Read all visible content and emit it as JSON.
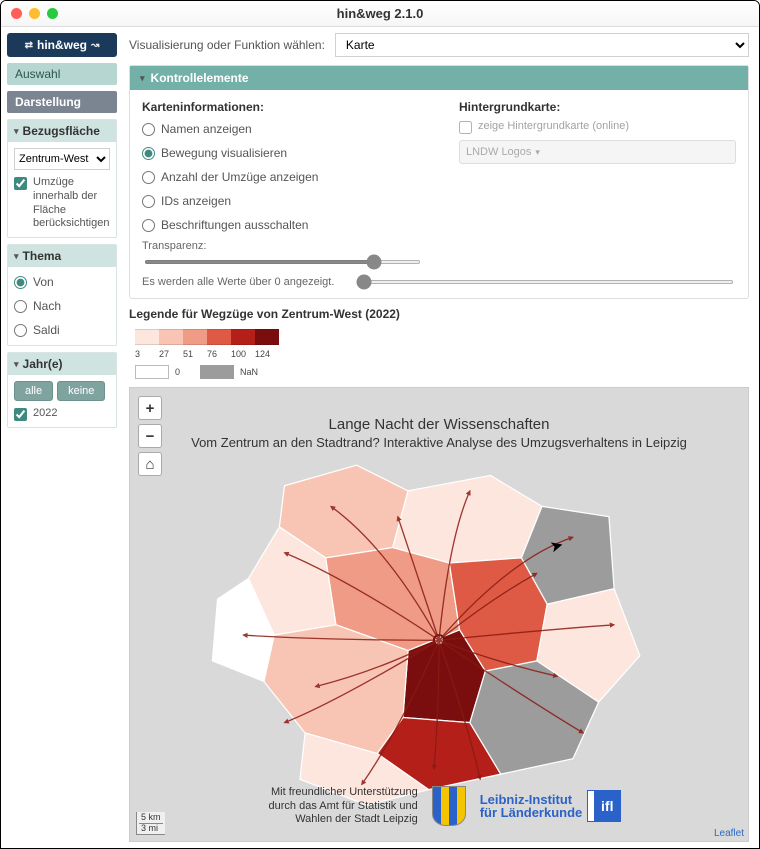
{
  "window": {
    "title": "hin&weg 2.1.0",
    "logo": "hin&weg"
  },
  "side_tabs": [
    {
      "label": "Auswahl",
      "active": false
    },
    {
      "label": "Darstellung",
      "active": true
    }
  ],
  "bezug": {
    "title": "Bezugsfläche",
    "select_value": "Zentrum-West",
    "checkbox_label": "Umzüge innerhalb der Fläche berücksichtigen",
    "checked": true
  },
  "thema": {
    "title": "Thema",
    "options": [
      {
        "label": "Von",
        "selected": true
      },
      {
        "label": "Nach",
        "selected": false
      },
      {
        "label": "Saldi",
        "selected": false
      }
    ]
  },
  "jahre": {
    "title": "Jahr(e)",
    "btn_all": "alle",
    "btn_none": "keine",
    "years": [
      {
        "label": "2022",
        "checked": true
      }
    ]
  },
  "main_top": {
    "label": "Visualisierung oder Funktion wählen:",
    "value": "Karte"
  },
  "kontroll": {
    "title": "Kontrollelemente",
    "left_title": "Karteninformationen:",
    "left_options": [
      {
        "label": "Namen anzeigen",
        "selected": false
      },
      {
        "label": "Bewegung visualisieren",
        "selected": true
      },
      {
        "label": "Anzahl der Umzüge anzeigen",
        "selected": false
      },
      {
        "label": "IDs anzeigen",
        "selected": false
      },
      {
        "label": "Beschriftungen ausschalten",
        "selected": false
      }
    ],
    "transparency_label": "Transparenz:",
    "right_title": "Hintergrundkarte:",
    "right_checkbox": "zeige Hintergrundkarte (online)",
    "right_select": "LNDW Logos",
    "note": "Es werden alle Werte über 0 angezeigt."
  },
  "legend": {
    "title": "Legende für Wegzüge von Zentrum-West (2022)",
    "ramp_colors": [
      "#fde6dd",
      "#f8c5b4",
      "#ef9b86",
      "#de5a45",
      "#b51f1a",
      "#7a0d0d"
    ],
    "ramp_colors_fixed": [
      "#fde6dd",
      "#f8c5b4",
      "#ef9b86",
      "#de5a45",
      "#b51f1a",
      "#7a0d0d"
    ],
    "ramp_labels": [
      "3",
      "27",
      "51",
      "76",
      "100",
      "124"
    ],
    "zero_label": "0",
    "nan_label": "NaN"
  },
  "map": {
    "controls": {
      "zoom_in": "+",
      "zoom_out": "−",
      "home": "⌂"
    },
    "title": "Lange Nacht der Wissenschaften",
    "subtitle": "Vom Zentrum an den Stadtrand? Interaktive Analyse des Umzugsverhaltens in Leipzig",
    "credits_text": "Mit freundlicher Unterstützung durch das Amt für Statistik und Wahlen der Stadt Leipzig",
    "ifl_line1": "Leibniz-Institut",
    "ifl_line2": "für Länderkunde",
    "ifl_box": "ifl",
    "scale": [
      "5 km",
      "3 mi"
    ],
    "attribution": "Leaflet"
  }
}
